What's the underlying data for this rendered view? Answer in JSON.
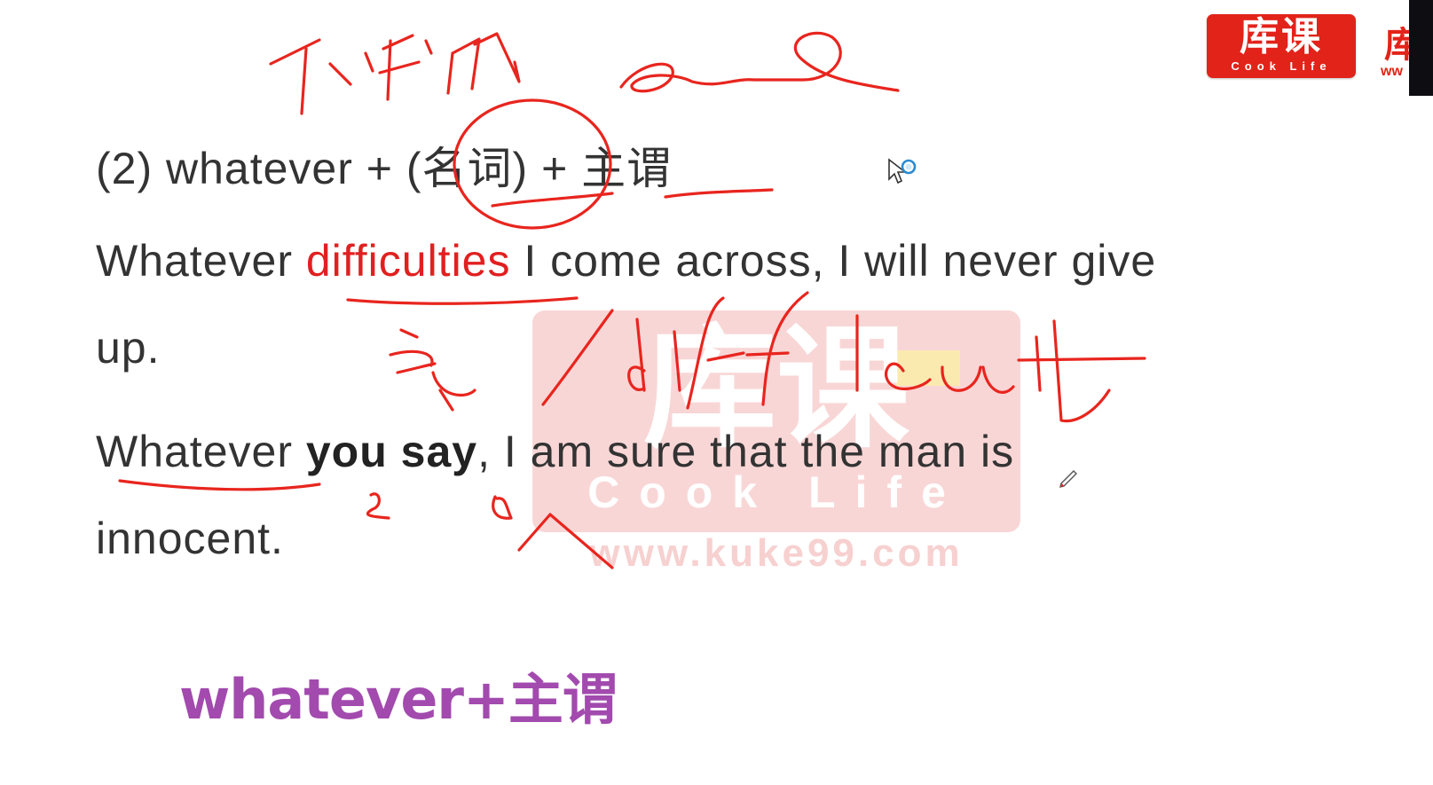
{
  "watermark": {
    "brand_cn": "库课",
    "brand_en": "Cook Life",
    "url": "www.kuke99.com",
    "registered": "®"
  },
  "logo": {
    "cn": "库课",
    "en": "Cook Life",
    "partial_cn": "库",
    "partial_url": "ww"
  },
  "lines": {
    "rule": {
      "prefix": "(2) whatever + ",
      "noun": "(名词)",
      "plus": " + ",
      "subject_predicate": "主谓"
    },
    "example1": {
      "part1": "Whatever ",
      "highlight": "difficulties",
      "part2": " I come across, I will never give"
    },
    "example1_cont": "up.",
    "example2": {
      "part1": "Whatever ",
      "bold": "you say",
      "part2": ", I am sure that the man is"
    },
    "example2_cont": "innocent."
  },
  "caption": "whatever+主谓",
  "colors": {
    "ink": "#e8251e",
    "highlight": "#e02020",
    "caption": "#a24aae",
    "logo_bg": "#e2231a",
    "watermark": "#f7c8c8"
  },
  "icons": [
    "magnifier-cursor-icon",
    "pen-icon"
  ]
}
